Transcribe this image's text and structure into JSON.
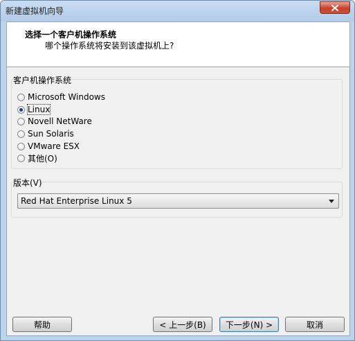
{
  "window": {
    "title": "新建虚拟机向导"
  },
  "header": {
    "title": "选择一个客户机操作系统",
    "subtitle": "哪个操作系统将安装到该虚拟机上?"
  },
  "os_group": {
    "label": "客户机操作系统",
    "options": [
      {
        "label": "Microsoft Windows",
        "checked": false
      },
      {
        "label": "Linux",
        "checked": true
      },
      {
        "label": "Novell NetWare",
        "checked": false
      },
      {
        "label": "Sun Solaris",
        "checked": false
      },
      {
        "label": "VMware ESX",
        "checked": false
      },
      {
        "label": "其他(O)",
        "checked": false
      }
    ]
  },
  "version_group": {
    "label": "版本(V)",
    "selected": "Red Hat Enterprise Linux 5"
  },
  "buttons": {
    "help": "帮助",
    "back": "< 上一步(B)",
    "next": "下一步(N) >",
    "cancel": "取消"
  },
  "icons": {
    "close": "close-icon",
    "dropdown": "chevron-down-icon"
  },
  "colors": {
    "close_button": "#c7402b",
    "default_button_border": "#3c7fb1",
    "radio_dot": "#1a3e7a"
  }
}
